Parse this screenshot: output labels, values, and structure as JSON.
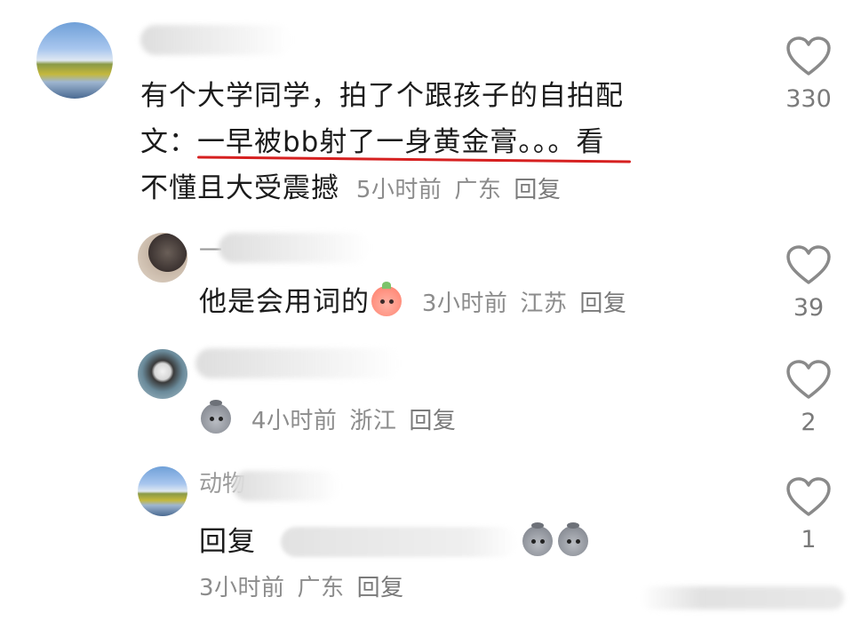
{
  "comments": [
    {
      "name_visible": "",
      "text_line1": "有个大学同学，拍了个跟孩子的自拍配",
      "text_line2": "文：一早被bb射了一身黄金膏。。。看",
      "text_line3": "不懂且大受震撼",
      "time": "5小时前",
      "location": "广东",
      "reply_label": "回复",
      "likes": "330"
    },
    {
      "name_visible": "一",
      "text": "他是会用词的",
      "emoji": "peach-face-emoji",
      "time": "3小时前",
      "location": "江苏",
      "reply_label": "回复",
      "likes": "39"
    },
    {
      "name_visible": "",
      "emoji": "sack-face-emoji",
      "time": "4小时前",
      "location": "浙江",
      "reply_label": "回复",
      "likes": "2"
    },
    {
      "name_visible": "动物",
      "reply_prefix": "回复",
      "emojis": [
        "sack-face-emoji",
        "sack-face-emoji"
      ],
      "time": "3小时前",
      "location": "广东",
      "reply_label": "回复",
      "likes": "1"
    }
  ],
  "icons": {
    "like": "heart-outline-icon"
  },
  "colors": {
    "underline": "#d62020",
    "meta": "#8c8c8c",
    "heart": "#8a8a8a"
  }
}
